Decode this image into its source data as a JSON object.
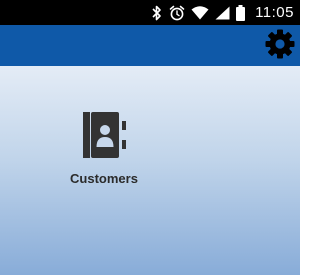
{
  "status_bar": {
    "time": "11:05",
    "icons": [
      "bluetooth-icon",
      "alarm-icon",
      "wifi-icon",
      "signal-icon",
      "battery-icon"
    ]
  },
  "app_bar": {
    "settings_icon": "gear-icon",
    "color": "#0f59a8"
  },
  "main": {
    "tiles": [
      {
        "label": "Customers",
        "icon": "address-book-icon"
      }
    ]
  }
}
